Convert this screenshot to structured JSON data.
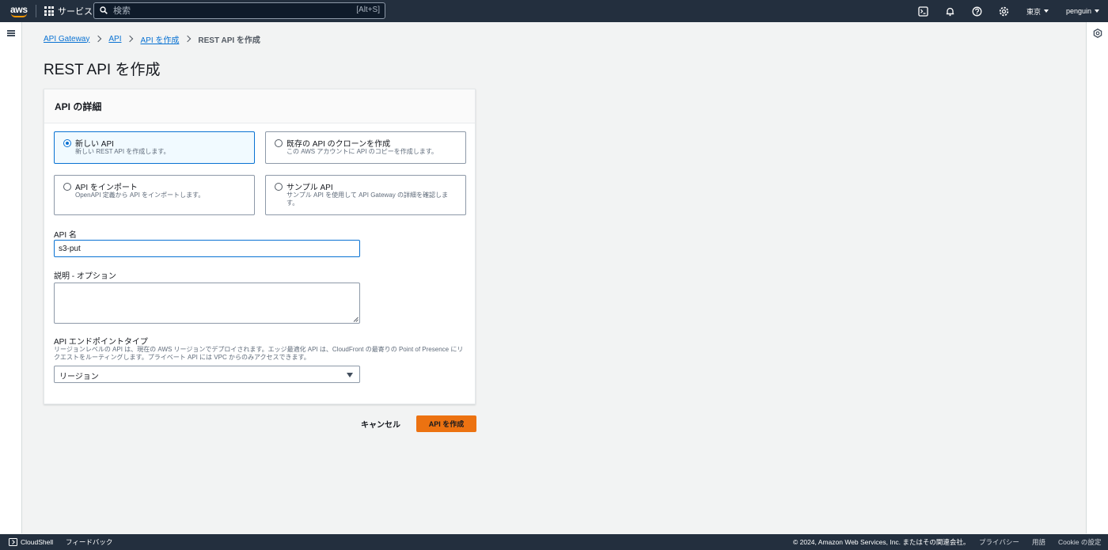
{
  "nav": {
    "logo_text": "aws",
    "services_label": "サービス",
    "search_placeholder": "検索",
    "search_shortcut": "[Alt+S]",
    "region": "東京",
    "user": "penguin",
    "icons": [
      "cloudshell-icon",
      "bell-icon",
      "help-icon",
      "settings-icon"
    ]
  },
  "breadcrumb": {
    "items": [
      "API Gateway",
      "API",
      "API を作成"
    ],
    "current": "REST API を作成"
  },
  "page": {
    "title": "REST API を作成"
  },
  "panel": {
    "heading": "API の詳細",
    "options": [
      {
        "title": "新しい API",
        "desc": "新しい REST API を作成します。",
        "selected": true
      },
      {
        "title": "既存の API のクローンを作成",
        "desc": "この AWS アカウントに API のコピーを作成します。",
        "selected": false
      },
      {
        "title": "API をインポート",
        "desc": "OpenAPI 定義から API をインポートします。",
        "selected": false
      },
      {
        "title": "サンプル API",
        "desc": "サンプル API を使用して API Gateway の詳細を確認します。",
        "selected": false
      }
    ],
    "api_name_label": "API 名",
    "api_name_value": "s3-put",
    "description_label": "説明 - オプション",
    "description_value": "",
    "endpoint_label": "API エンドポイントタイプ",
    "endpoint_hint": "リージョンレベルの API は、現在の AWS リージョンでデプロイされます。エッジ最適化 API は、CloudFront の最寄りの Point of Presence にリクエストをルーティングします。プライベート API には VPC からのみアクセスできます。",
    "endpoint_value": "リージョン"
  },
  "actions": {
    "cancel": "キャンセル",
    "create": "API を作成"
  },
  "footer": {
    "cloudshell": "CloudShell",
    "feedback": "フィードバック",
    "copyright": "© 2024, Amazon Web Services, Inc. またはその関連会社。",
    "privacy": "プライバシー",
    "terms": "用語",
    "cookie": "Cookie の設定"
  },
  "colors": {
    "nav_bg": "#232f3e",
    "link": "#0972d3",
    "primary": "#ec7211"
  }
}
